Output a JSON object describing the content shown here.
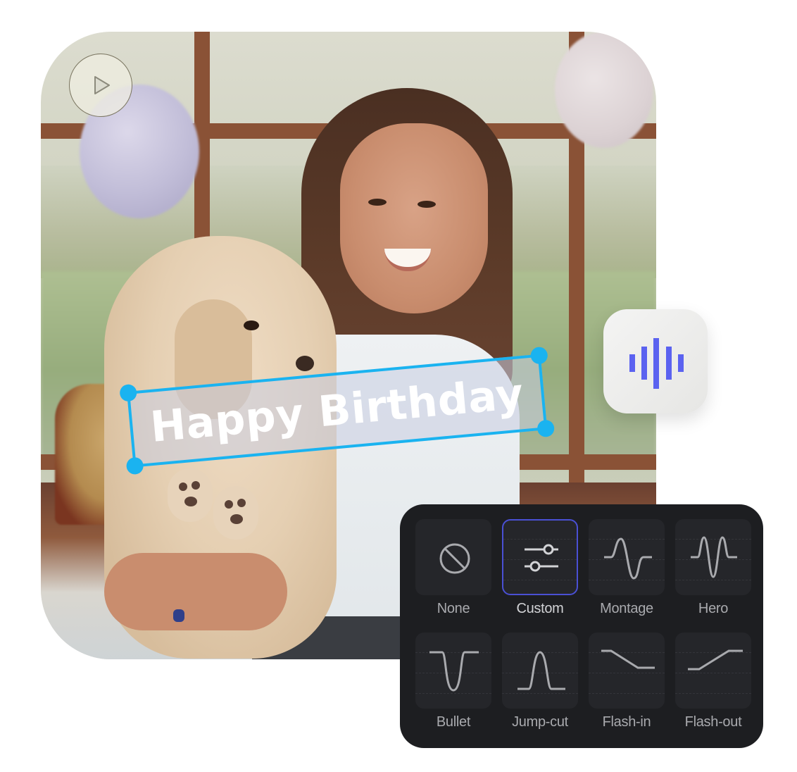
{
  "photo": {
    "description": "girl-holding-poodle-at-birthday-party",
    "play_button": {
      "icon": "play-icon",
      "label": "Play"
    }
  },
  "caption": {
    "text": "Happy Birthday",
    "selection_color": "#1ab3f0"
  },
  "audio_button": {
    "icon": "audio-waveform-icon",
    "accent": "#5b62f0"
  },
  "transitions": {
    "selected": "Custom",
    "selected_border_color": "#4a50d4",
    "items": [
      {
        "label": "None",
        "icon": "none-icon"
      },
      {
        "label": "Custom",
        "icon": "sliders-icon"
      },
      {
        "label": "Montage",
        "icon": "montage-curve-icon"
      },
      {
        "label": "Hero",
        "icon": "hero-curve-icon"
      },
      {
        "label": "Bullet",
        "icon": "bullet-curve-icon"
      },
      {
        "label": "Jump-cut",
        "icon": "jump-cut-curve-icon"
      },
      {
        "label": "Flash-in",
        "icon": "flash-in-curve-icon"
      },
      {
        "label": "Flash-out",
        "icon": "flash-out-curve-icon"
      }
    ]
  }
}
